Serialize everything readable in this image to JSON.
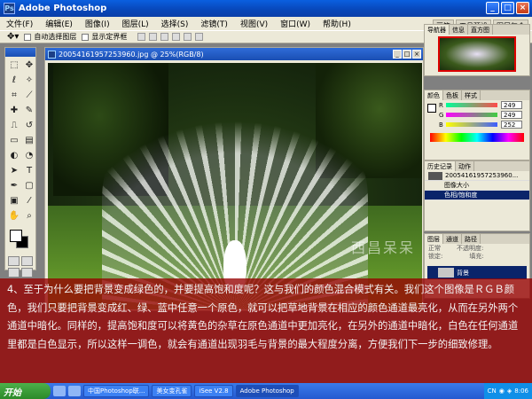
{
  "app": {
    "title": "Adobe Photoshop",
    "icon": "Ps"
  },
  "window_buttons": {
    "minimize": "_",
    "maximize": "□",
    "close": "×"
  },
  "menu": [
    "文件(F)",
    "编辑(E)",
    "图像(I)",
    "图层(L)",
    "选择(S)",
    "滤镜(T)",
    "视图(V)",
    "窗口(W)",
    "帮助(H)"
  ],
  "options": {
    "auto_select": "自动选择图层",
    "show_bounds": "显示定界框"
  },
  "palette_well": [
    "画笔",
    "工具预设",
    "图层复合"
  ],
  "document": {
    "title": "20054161957253960.jpg @ 25%(RGB/8)"
  },
  "navigator": {
    "tabs": [
      "导航器",
      "信息",
      "直方图"
    ]
  },
  "color": {
    "tabs": [
      "颜色",
      "色板",
      "样式"
    ],
    "channels": [
      {
        "label": "R",
        "value": "249",
        "color": "#ff4a4a"
      },
      {
        "label": "G",
        "value": "249",
        "color": "#3fcf3f"
      },
      {
        "label": "B",
        "value": "252",
        "color": "#3d5dff"
      }
    ]
  },
  "history": {
    "tabs": [
      "历史记录",
      "动作"
    ],
    "snapshot": "20054161957253960...",
    "items": [
      {
        "label": "图像大小",
        "selected": false
      },
      {
        "label": "色相/饱和度",
        "selected": true
      }
    ]
  },
  "layers": {
    "tabs": [
      "图层",
      "通道",
      "路径"
    ],
    "mode": "正常",
    "opacity_label": "不透明度:",
    "lock_label": "锁定:",
    "fill_label": "填充:",
    "layer_name": "背景"
  },
  "watermark": "西昌呆呆",
  "caption": "4、至于为什么要把背景变成绿色的，并要提高饱和度呢？这与我们的颜色混合模式有关。我们这个图像是ＲＧＢ颜色，我们只要把背景变成红、绿、蓝中任意一个原色，就可以把草地背景在相应的颜色通道最亮化，从而在另外两个通道中暗化。同样的，提高饱和度可以将黄色的杂草在原色通道中更加亮化，在另外的通道中暗化，白色在任何通道里都是白色显示，所以这样一调色，就会有通道出现羽毛与背景的最大程度分离，方便我们下一步的细致修理。",
  "taskbar": {
    "start": "开始",
    "tasks": [
      "中国Photoshop联...",
      "美女变孔雀",
      "iSee V2.8",
      "Adobe Photoshop"
    ],
    "tray_lang": "CN",
    "time": "8:06"
  }
}
